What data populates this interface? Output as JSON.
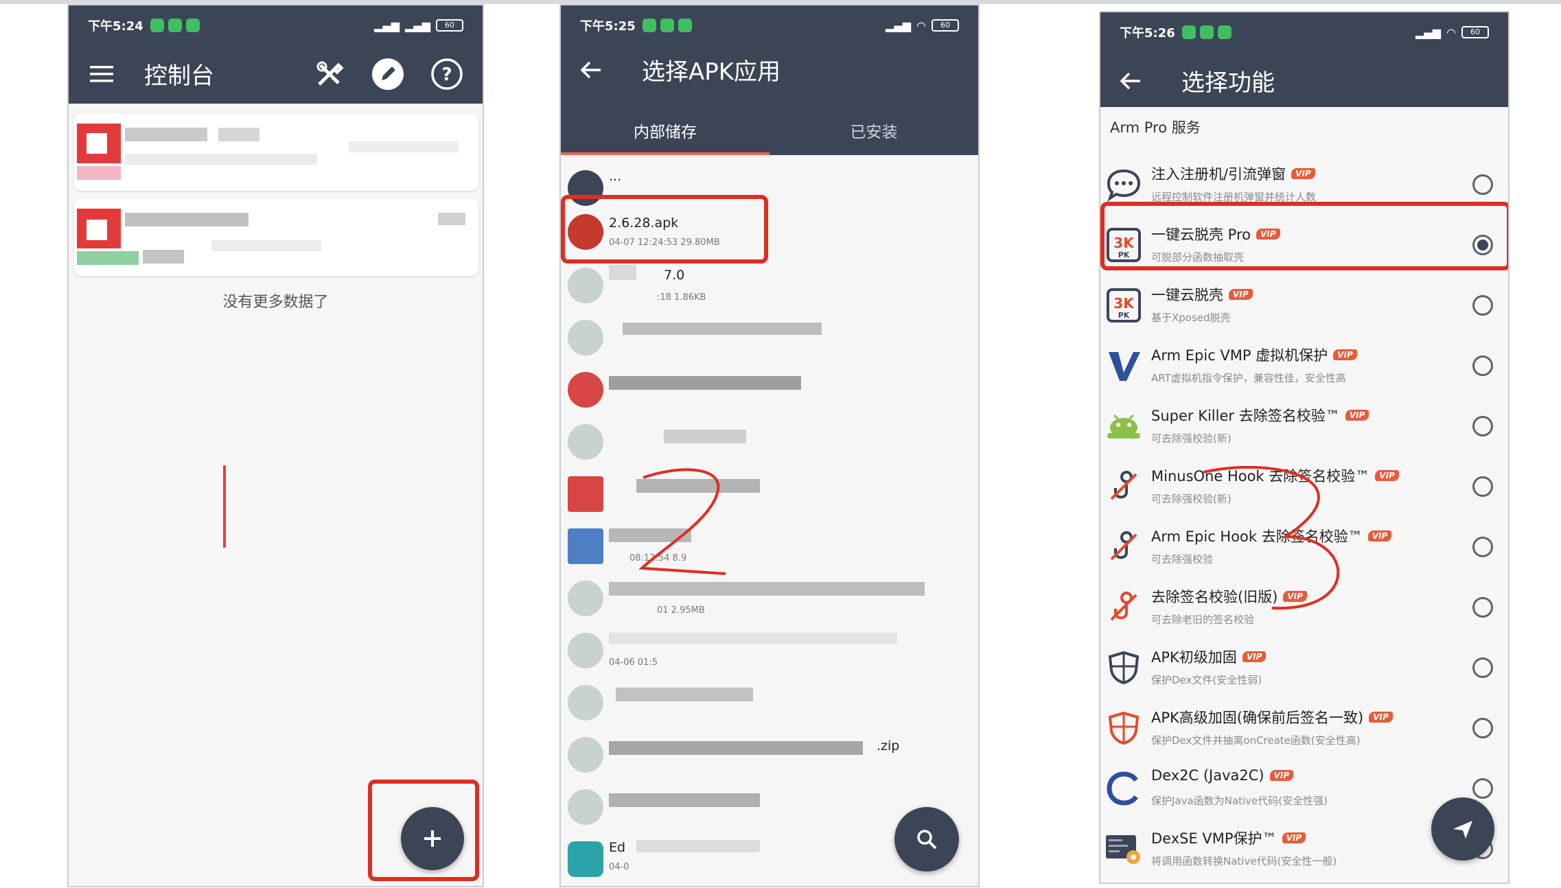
{
  "colors": {
    "app_bar": "#3b4556",
    "accent": "#e96a4d",
    "annotation_red": "#e02d22",
    "vip_badge": "#e85b3a"
  },
  "phone1": {
    "status": {
      "time": "下午5:24",
      "battery": "60"
    },
    "title": "控制台",
    "actions": [
      "tools-icon",
      "edit-icon",
      "help-icon"
    ],
    "empty_text": "没有更多数据了",
    "fab_icon": "plus-icon"
  },
  "phone2": {
    "status": {
      "time": "下午5:25",
      "battery": "60"
    },
    "title": "选择APK应用",
    "tabs": [
      {
        "label": "内部储存",
        "active": true
      },
      {
        "label": "已安装",
        "active": false
      }
    ],
    "files": [
      {
        "name": "...",
        "meta": ""
      },
      {
        "name": "2.6.28.apk",
        "meta": "04-07 12:24:53  29.80MB"
      },
      {
        "name": "7.0",
        "meta": ":18  1.86KB"
      },
      {
        "name": "",
        "meta": ""
      },
      {
        "name": "",
        "meta": ""
      },
      {
        "name": "",
        "meta": ""
      },
      {
        "name": "",
        "meta": ""
      },
      {
        "name": "",
        "meta": "08:12:54  8.9"
      },
      {
        "name": "",
        "meta": "01  2.95MB"
      },
      {
        "name": "",
        "meta": "04-06 01:5"
      },
      {
        "name": "",
        "meta": ""
      },
      {
        "name": ".zip",
        "meta": ""
      },
      {
        "name": "",
        "meta": ""
      },
      {
        "name": "Ed",
        "meta": "04-0"
      }
    ],
    "fab_icon": "search-icon"
  },
  "phone3": {
    "status": {
      "time": "下午5:26",
      "battery": "60"
    },
    "title": "选择功能",
    "section": "Arm Pro 服务",
    "vip_label": "VIP",
    "features": [
      {
        "title": "注入注册机/引流弹窗",
        "desc": "远程控制软件注册机弹窗并统计人数",
        "icon": "chat-icon",
        "checked": false
      },
      {
        "title": "一键云脱壳 Pro",
        "desc": "可脱部分函数抽取壳",
        "icon": "pk-icon",
        "checked": true
      },
      {
        "title": "一键云脱壳",
        "desc": "基于Xposed脱壳",
        "icon": "pk-icon",
        "checked": false
      },
      {
        "title": "Arm Epic VMP 虚拟机保护",
        "desc": "ART虚拟机指令保护，兼容性佳，安全性高",
        "icon": "v-logo-icon",
        "checked": false
      },
      {
        "title": "Super Killer 去除签名校验™",
        "desc": "可去除强校验(新)",
        "icon": "android-icon",
        "checked": false
      },
      {
        "title": "MinusOne Hook 去除签名校验™",
        "desc": "可去除强校验(新)",
        "icon": "hook-icon",
        "checked": false
      },
      {
        "title": "Arm Epic Hook 去除签名校验™",
        "desc": "可去除强校验",
        "icon": "hook-icon",
        "checked": false
      },
      {
        "title": "去除签名校验(旧版)",
        "desc": "可去除老旧的签名校验",
        "icon": "hook-red-icon",
        "checked": false
      },
      {
        "title": "APK初级加固",
        "desc": "保护Dex文件(安全性弱)",
        "icon": "shield-icon",
        "checked": false
      },
      {
        "title": "APK高级加固(确保前后签名一致)",
        "desc": "保护Dex文件并抽离onCreate函数(安全性高)",
        "icon": "shield-red-icon",
        "checked": false
      },
      {
        "title": "Dex2C (Java2C)",
        "desc": "保护Java函数为Native代码(安全性强)",
        "icon": "c-logo-icon",
        "checked": false
      },
      {
        "title": "DexSE VMP保护™",
        "desc": "将调用函数转换Native代码(安全性一般)",
        "icon": "code-gear-icon",
        "checked": false
      }
    ],
    "fab_icon": "send-icon"
  }
}
